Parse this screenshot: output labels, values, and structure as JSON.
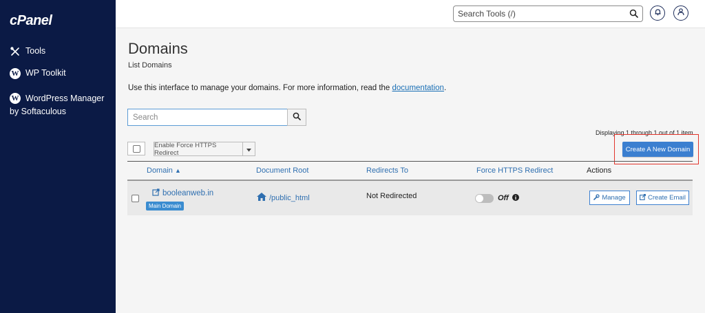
{
  "sidebar": {
    "logo": "cPanel",
    "items": [
      {
        "label": "Tools",
        "icon": "tools-icon"
      },
      {
        "label": "WP Toolkit",
        "icon": "wordpress-icon"
      },
      {
        "label": "WordPress Manager",
        "label_line2": "by Softaculous",
        "icon": "wordpress-icon"
      }
    ]
  },
  "topbar": {
    "search_placeholder": "Search Tools (/)"
  },
  "page": {
    "title": "Domains",
    "subtitle": "List Domains",
    "intro_text": "Use this interface to manage your domains. For more information, read the ",
    "intro_link": "documentation",
    "intro_end": ".",
    "search_placeholder": "Search",
    "displaying": "Displaying 1 through 1 out of 1 item",
    "force_https_button": "Enable Force HTTPS Redirect",
    "create_button": "Create A New Domain"
  },
  "table": {
    "columns": [
      "Domain",
      "Document Root",
      "Redirects To",
      "Force HTTPS Redirect",
      "Actions"
    ],
    "sort_indicator": "▲",
    "rows": [
      {
        "domain": "booleanweb.in",
        "badge": "Main Domain",
        "document_root": "/public_html",
        "redirects_to": "Not Redirected",
        "force_https": "Off",
        "actions": [
          "Manage",
          "Create Email"
        ]
      }
    ]
  },
  "colors": {
    "sidebar_bg": "#0b1a45",
    "link": "#2f6fb0",
    "primary_button": "#3b7fd0",
    "highlight": "#e2332a"
  }
}
